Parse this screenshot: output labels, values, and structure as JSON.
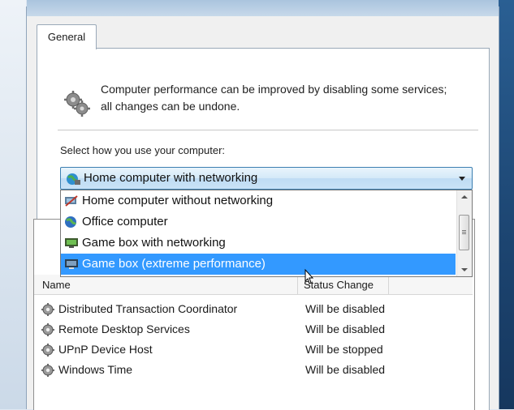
{
  "tab": {
    "label": "General"
  },
  "intro": {
    "text": "Computer performance can be improved by disabling some services; all changes can be undone."
  },
  "selector": {
    "label": "Select how you use your computer:",
    "selected": "Home computer with networking",
    "options": [
      {
        "label": "Home computer without networking",
        "icon": "network-off-icon"
      },
      {
        "label": "Office computer",
        "icon": "globe-icon"
      },
      {
        "label": "Game box with networking",
        "icon": "monitor-icon"
      },
      {
        "label": "Game box (extreme performance)",
        "icon": "monitor-icon",
        "highlighted": true
      }
    ]
  },
  "services": {
    "columns": {
      "name": "Name",
      "status": "Status Change"
    },
    "rows": [
      {
        "name": "Distributed Transaction Coordinator",
        "status": "Will be disabled",
        "icon": "gear-icon"
      },
      {
        "name": "Remote Desktop Services",
        "status": "Will be disabled",
        "icon": "gear-icon"
      },
      {
        "name": "UPnP Device Host",
        "status": "Will be stopped",
        "icon": "gear-icon"
      },
      {
        "name": "Windows Time",
        "status": "Will be disabled",
        "icon": "gear-icon"
      }
    ]
  },
  "colors": {
    "highlight": "#3399ff",
    "combo_border": "#3c7fb1"
  }
}
